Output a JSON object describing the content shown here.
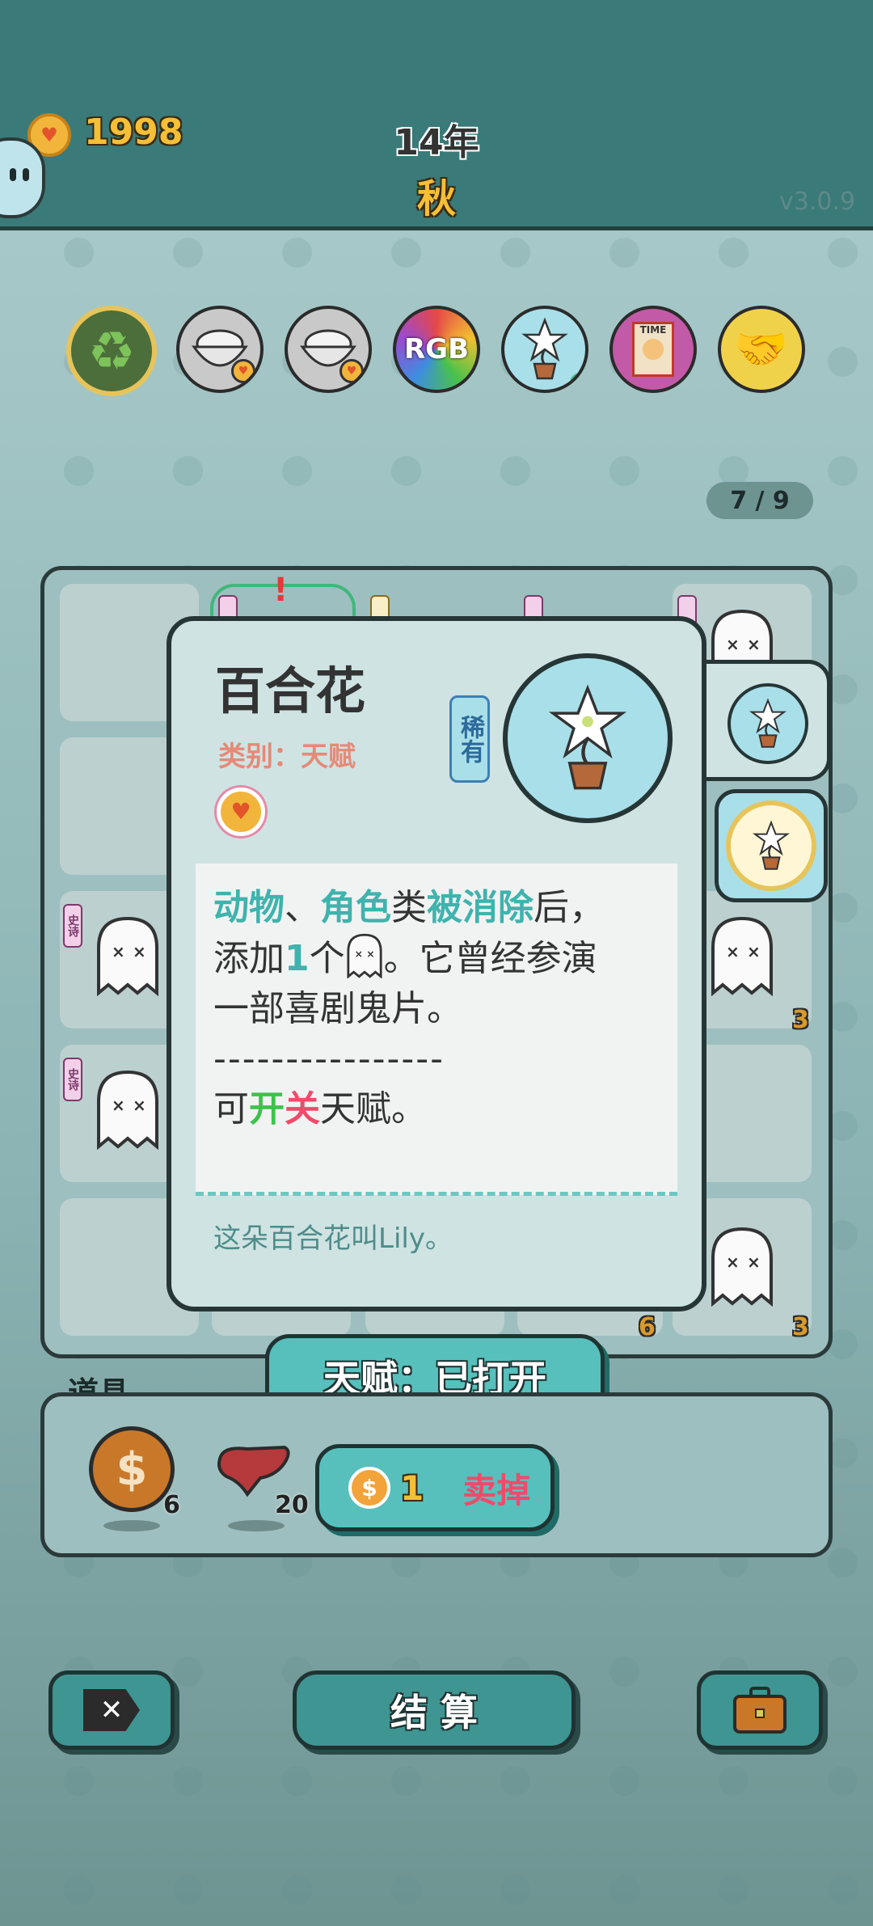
{
  "header": {
    "coins": "1998",
    "year": "14年",
    "season": "秋",
    "version": "v3.0.9"
  },
  "talents_bar": {
    "items": [
      {
        "icon": "recycle-icon",
        "color": "#7dc25a"
      },
      {
        "icon": "rice-bowl-icon",
        "color": "#e0e0e0"
      },
      {
        "icon": "rice-bowl-icon",
        "color": "#e0e0e0"
      },
      {
        "icon": "rgb-icon",
        "label": "RGB"
      },
      {
        "icon": "lily-icon",
        "color": "#a9e6f5"
      },
      {
        "icon": "time-magazine-icon",
        "label": "TIME"
      },
      {
        "icon": "handshake-icon",
        "color": "#f0d24a"
      }
    ]
  },
  "board": {
    "page": "7 / 9",
    "tag_text": "史诗",
    "counts": [
      "3",
      "6",
      "3"
    ]
  },
  "popup": {
    "title": "百合花",
    "category": "类别：天赋",
    "rarity": "稀有",
    "desc": {
      "p1_a": "动物",
      "p1_b": "、",
      "p1_c": "角色",
      "p1_d": "类",
      "p1_e": "被消除",
      "p1_f": "后，",
      "p2_a": "添加",
      "p2_b": "1",
      "p2_c": "个",
      "p2_d": "。它曾经参演",
      "p3": "一部喜剧鬼片。",
      "sep": "----------------",
      "p4_a": "可",
      "p4_b": "开",
      "p4_c": "关",
      "p4_d": "天赋。"
    },
    "flavor": "这朵百合花叫Lily。"
  },
  "toggle_button": {
    "label": "天赋：已打开"
  },
  "sell_button": {
    "price": "1",
    "label": "卖掉"
  },
  "items_panel": {
    "title": "道具",
    "items": [
      {
        "icon": "dollar-coin-icon",
        "count": "6"
      },
      {
        "icon": "liver-icon",
        "count": "20"
      }
    ]
  },
  "bottom": {
    "settle_label": "结 算"
  },
  "colors": {
    "accent": "#4fb9b5",
    "header_bg": "#3a7a78",
    "coin": "#f2b53b",
    "highlight_teal": "#3fb3ad",
    "highlight_red": "#f04a6a",
    "highlight_green": "#3dc24b"
  }
}
